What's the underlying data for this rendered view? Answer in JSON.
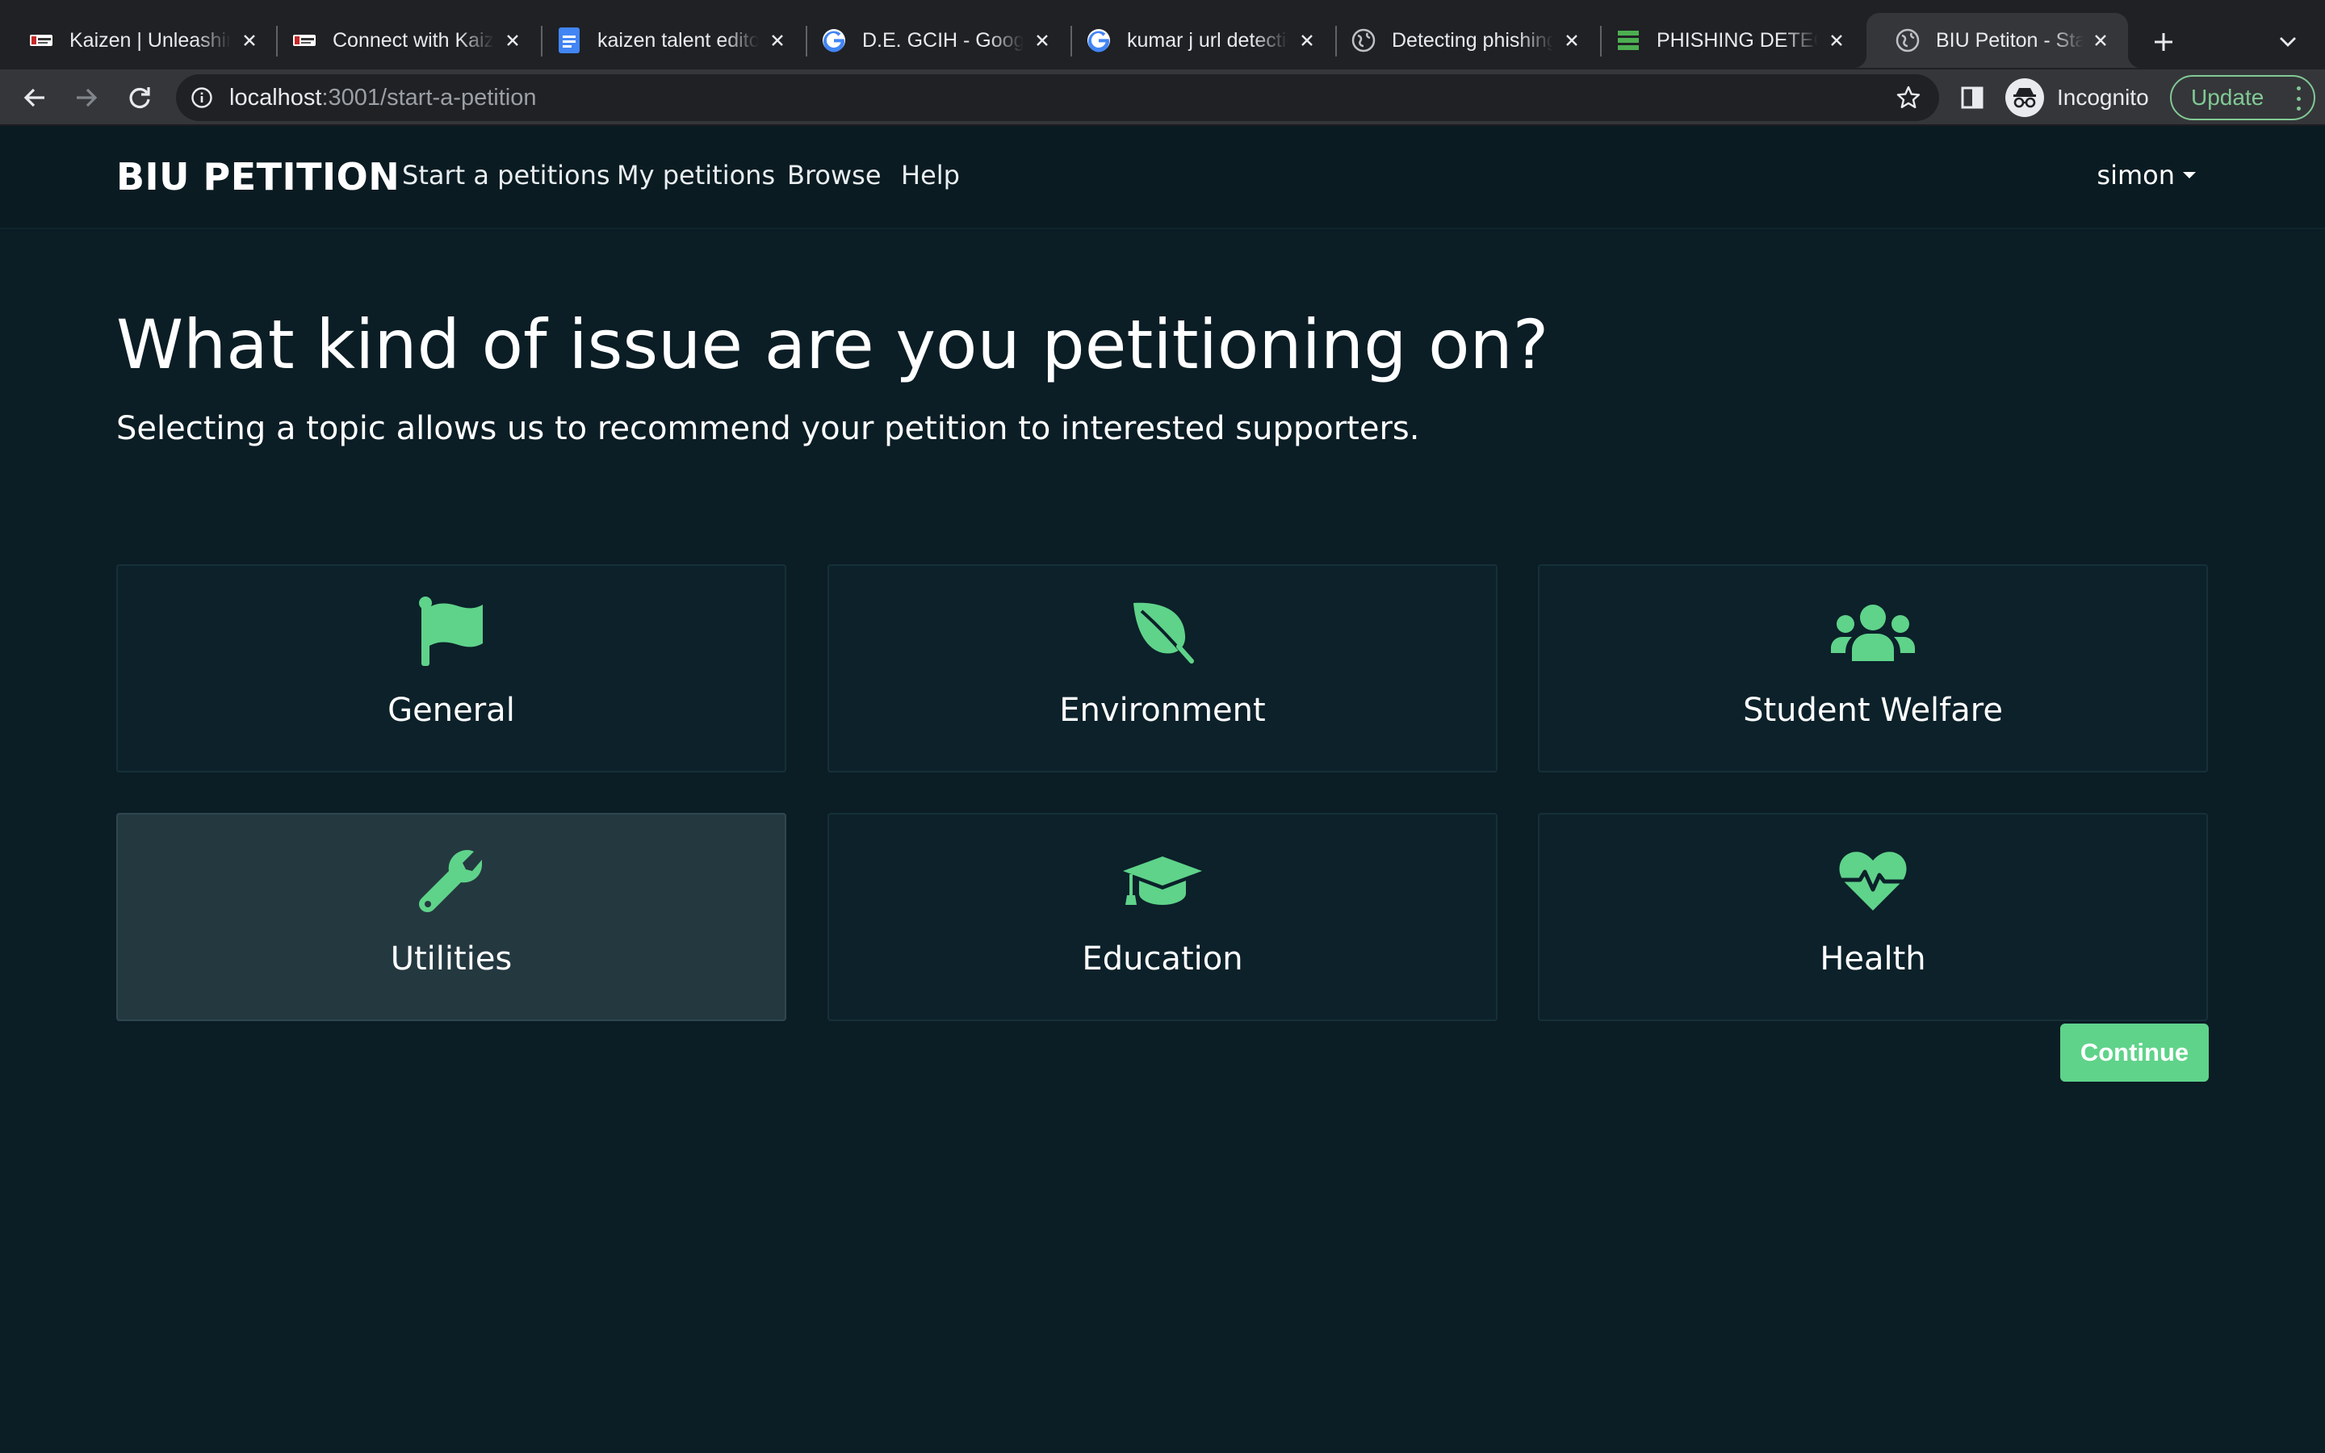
{
  "browser": {
    "tabs": [
      {
        "title": "Kaizen | Unleashing",
        "favicon": "kaizen-logo-icon"
      },
      {
        "title": "Connect with Kaizen",
        "favicon": "kaizen-logo-icon"
      },
      {
        "title": "kaizen talent editor",
        "favicon": "google-docs-icon"
      },
      {
        "title": "D.E. GCIH - Google",
        "favicon": "google-icon"
      },
      {
        "title": "kumar j url detection",
        "favicon": "google-icon"
      },
      {
        "title": "Detecting phishing",
        "favicon": "globe-icon"
      },
      {
        "title": "PHISHING DETECTION",
        "favicon": "spam-icon"
      },
      {
        "title": "BIU Petiton - Start",
        "favicon": "globe-icon",
        "active": true
      }
    ],
    "url_host": "localhost",
    "url_path": ":3001/start-a-petition",
    "profile_label": "Incognito",
    "update_label": "Update"
  },
  "nav": {
    "brand": "BIU PETITION",
    "links": [
      "Start a petitions",
      "My petitions",
      "Browse",
      "Help"
    ],
    "user": "simon"
  },
  "main": {
    "title": "What kind of issue are you petitioning on?",
    "subtitle": "Selecting a topic allows us to recommend your petition to interested supporters.",
    "topics": [
      {
        "label": "General",
        "icon": "flag-icon",
        "selected": false
      },
      {
        "label": "Environment",
        "icon": "leaf-icon",
        "selected": false
      },
      {
        "label": "Student Welfare",
        "icon": "users-icon",
        "selected": false
      },
      {
        "label": "Utilities",
        "icon": "wrench-icon",
        "selected": true
      },
      {
        "label": "Education",
        "icon": "graduation-cap-icon",
        "selected": false
      },
      {
        "label": "Health",
        "icon": "heartbeat-icon",
        "selected": false
      }
    ],
    "continue_label": "Continue"
  },
  "colors": {
    "accent": "#5fd38a",
    "page_bg": "#0b1d25",
    "card_bg": "#0c212a",
    "card_selected_bg": "#243840"
  }
}
